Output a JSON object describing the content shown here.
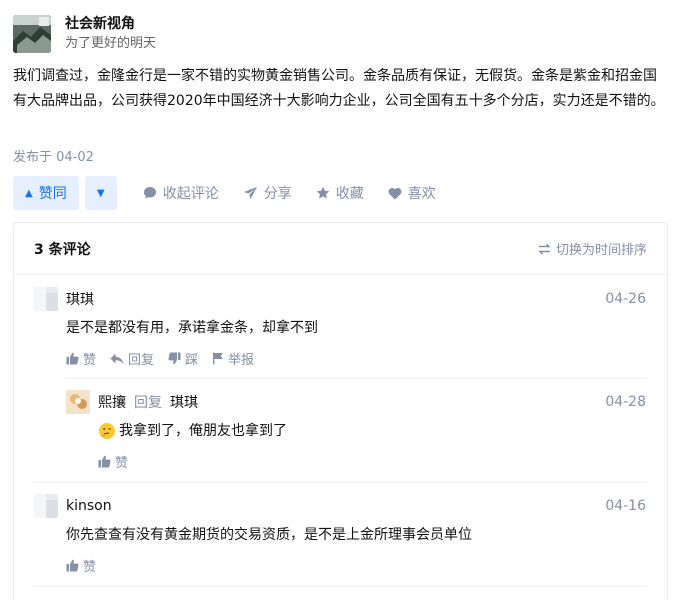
{
  "author": {
    "name": "社会新视角",
    "bio": "为了更好的明天",
    "avatar_icon": "avatar-landscape"
  },
  "post": {
    "content": "我们调查过，金隆金行是一家不错的实物黄金销售公司。金条品质有保证，无假货。金条是紫金和招金国有大品牌出品，公司获得2020年中国经济十大影响力企业，公司全国有五十多个分店，实力还是不错的。",
    "published": "发布于 04-02"
  },
  "actions": {
    "upvote": "赞同",
    "collapse_comments": "收起评论",
    "share": "分享",
    "collect": "收藏",
    "like": "喜欢"
  },
  "comments": {
    "count_label": "3 条评论",
    "sort_label": "切换为时间排序",
    "items": [
      {
        "author": "琪琪",
        "date": "04-26",
        "text": "是不是都没有用，承诺拿金条，却拿不到",
        "actions": {
          "like": "赞",
          "reply": "回复",
          "dislike": "踩",
          "report": "举报"
        }
      },
      {
        "author": "熙攘",
        "reply_word": "回复",
        "reply_to": "琪琪",
        "date": "04-28",
        "text": "我拿到了，俺朋友也拿到了",
        "emoji_icon": "thinking-emoji-icon",
        "actions": {
          "like": "赞"
        }
      },
      {
        "author": "kinson",
        "date": "04-16",
        "text": "你先查查有没有黄金期货的交易资质，是不是上金所理事会员单位",
        "actions": {
          "like": "赞"
        }
      }
    ]
  },
  "colors": {
    "accent": "#1772f6",
    "accent_bg": "#e5efff",
    "muted": "#8590a6"
  }
}
